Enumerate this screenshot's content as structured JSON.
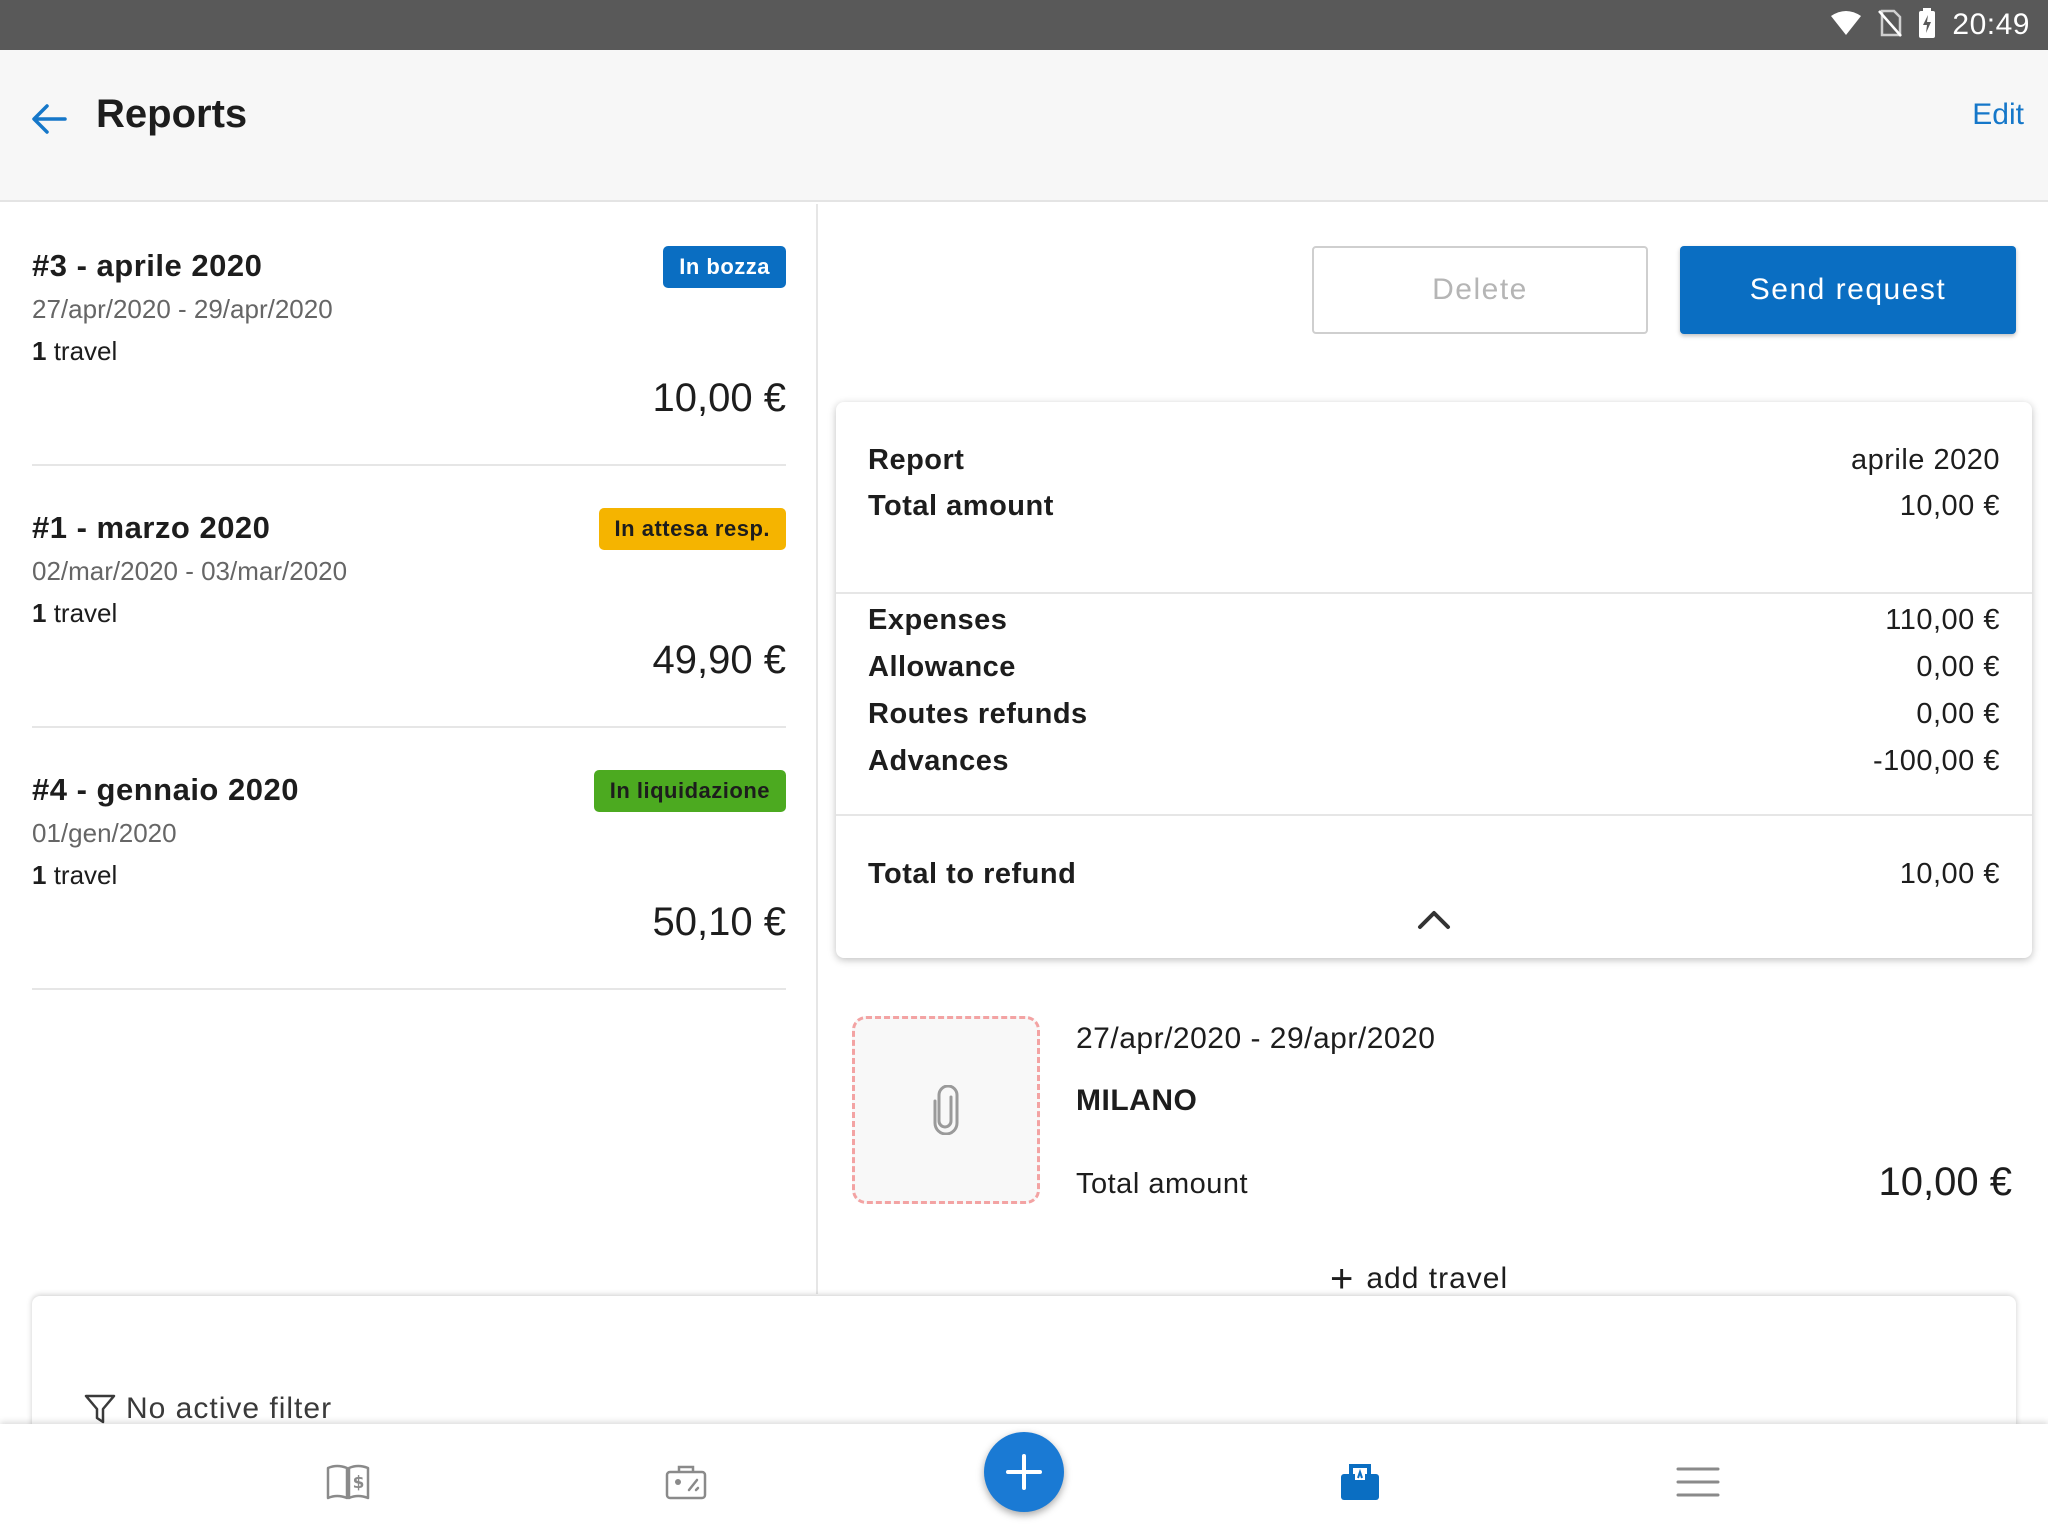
{
  "status_bar": {
    "time": "20:49"
  },
  "header": {
    "title": "Reports",
    "edit_label": "Edit"
  },
  "colors": {
    "accent": "#0a6ec2",
    "badge_draft": "#0a6ec2",
    "badge_pending": "#f5b400",
    "badge_liquidation": "#4caa20",
    "attach_border": "#f3a3a3"
  },
  "reports": [
    {
      "title": "#3 - aprile 2020",
      "dates": "27/apr/2020 - 29/apr/2020",
      "travel_count": "1",
      "travel_word": "travel",
      "amount": "10,00 €",
      "status": "In bozza"
    },
    {
      "title": "#1 - marzo 2020",
      "dates": "02/mar/2020 - 03/mar/2020",
      "travel_count": "1",
      "travel_word": "travel",
      "amount": "49,90 €",
      "status": "In attesa resp."
    },
    {
      "title": "#4 - gennaio 2020",
      "dates": "01/gen/2020",
      "travel_count": "1",
      "travel_word": "travel",
      "amount": "50,10 €",
      "status": "In liquidazione"
    }
  ],
  "actions": {
    "delete_label": "Delete",
    "send_label": "Send request"
  },
  "summary": {
    "report_label": "Report",
    "report_value": "aprile 2020",
    "total_label": "Total amount",
    "total_value": "10,00 €",
    "expenses_label": "Expenses",
    "expenses_value": "110,00 €",
    "allowance_label": "Allowance",
    "allowance_value": "0,00 €",
    "routes_label": "Routes refunds",
    "routes_value": "0,00 €",
    "advances_label": "Advances",
    "advances_value": "-100,00 €",
    "refund_label": "Total to refund",
    "refund_value": "10,00 €"
  },
  "travel": {
    "dates": "27/apr/2020 - 29/apr/2020",
    "city": "MILANO",
    "total_label": "Total amount",
    "total_value": "10,00 €"
  },
  "add_travel_label": "add travel",
  "filter": {
    "label": "No active filter"
  },
  "bottom_nav": {
    "items": [
      "book-money-icon",
      "briefcase-icon",
      "add-icon",
      "reports-icon",
      "menu-icon"
    ],
    "active": "reports-icon"
  }
}
